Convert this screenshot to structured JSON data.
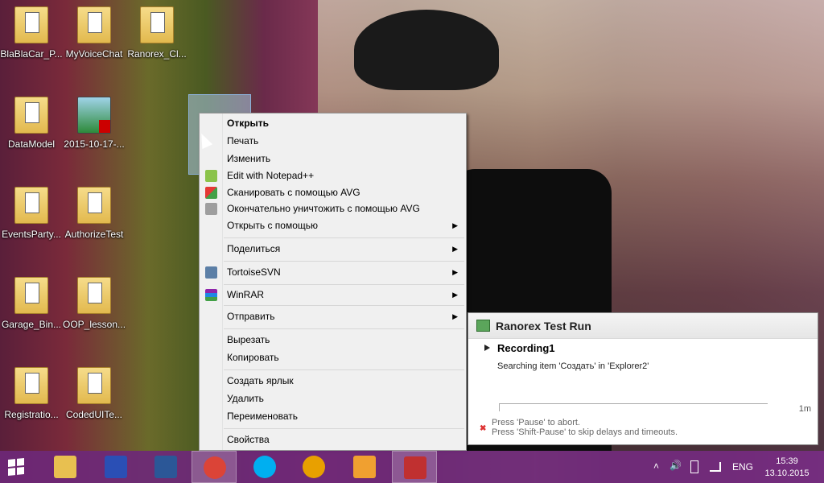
{
  "desktop": {
    "icons": [
      {
        "label": "BlaBlaCar_P..."
      },
      {
        "label": "MyVoiceChat"
      },
      {
        "label": "Ranorex_Cl..."
      },
      {
        "label": "DataModel"
      },
      {
        "label": "2015-10-17-..."
      },
      {
        "label": "EventsParty..."
      },
      {
        "label": "AuthorizeTest"
      },
      {
        "label": "Garage_Bin..."
      },
      {
        "label": "OOP_lesson..."
      },
      {
        "label": "Registratio..."
      },
      {
        "label": "CodedUITe..."
      }
    ]
  },
  "context_menu": {
    "items": [
      {
        "label": "Открыть",
        "bold": true
      },
      {
        "label": "Печать"
      },
      {
        "label": "Изменить"
      },
      {
        "label": "Edit with Notepad++",
        "icon": "notepad-plus-icon"
      },
      {
        "label": "Сканировать с помощью AVG",
        "icon": "avg-scan-icon"
      },
      {
        "label": "Окончательно уничтожить с помощью AVG",
        "icon": "avg-shredder-icon"
      },
      {
        "label": "Открыть с помощью",
        "submenu": true
      },
      {
        "label": "Поделиться",
        "submenu": true
      },
      {
        "label": "TortoiseSVN",
        "submenu": true,
        "icon": "tortoise-svn-icon"
      },
      {
        "label": "WinRAR",
        "submenu": true,
        "icon": "winrar-icon"
      },
      {
        "label": "Отправить",
        "submenu": true
      },
      {
        "label": "Вырезать"
      },
      {
        "label": "Копировать"
      },
      {
        "label": "Создать ярлык"
      },
      {
        "label": "Удалить"
      },
      {
        "label": "Переименовать"
      },
      {
        "label": "Свойства"
      }
    ],
    "submenu_arrow": "▶"
  },
  "ranorex_panel": {
    "title": "Ranorex Test Run",
    "recording": "Recording1",
    "status": "Searching item 'Создать' in 'Explorer2'",
    "eta": "1m",
    "progress_fraction": 0.0,
    "hint_line1": "Press 'Pause' to abort.",
    "hint_line2": "Press 'Shift-Pause' to skip delays and timeouts.",
    "abort_glyph": "✖"
  },
  "taskbar": {
    "apps": [
      {
        "name": "File Explorer",
        "icon": "explorer-icon",
        "color": "#e8c050"
      },
      {
        "name": "Save",
        "icon": "floppy-icon",
        "color": "#2a4fb5"
      },
      {
        "name": "Word",
        "icon": "word-icon",
        "color": "#2b5797"
      },
      {
        "name": "Chrome",
        "icon": "chrome-icon",
        "color": "#db4437",
        "active": true
      },
      {
        "name": "Skype",
        "icon": "skype-icon",
        "color": "#00aff0"
      },
      {
        "name": "AIMP",
        "icon": "aimp-icon",
        "color": "#e8a000"
      },
      {
        "name": "FL Studio",
        "icon": "fl-studio-icon",
        "color": "#f0a030"
      },
      {
        "name": "Ranorex",
        "icon": "ranorex-icon",
        "color": "#c03030",
        "active": true
      }
    ],
    "tray": {
      "language": "ENG",
      "time": "15:39",
      "date": "13.10.2015",
      "chevron": "˄",
      "volume": "🔊"
    }
  },
  "colors": {
    "taskbar": "#6e2878",
    "menu_bg": "#f0f0f0"
  }
}
